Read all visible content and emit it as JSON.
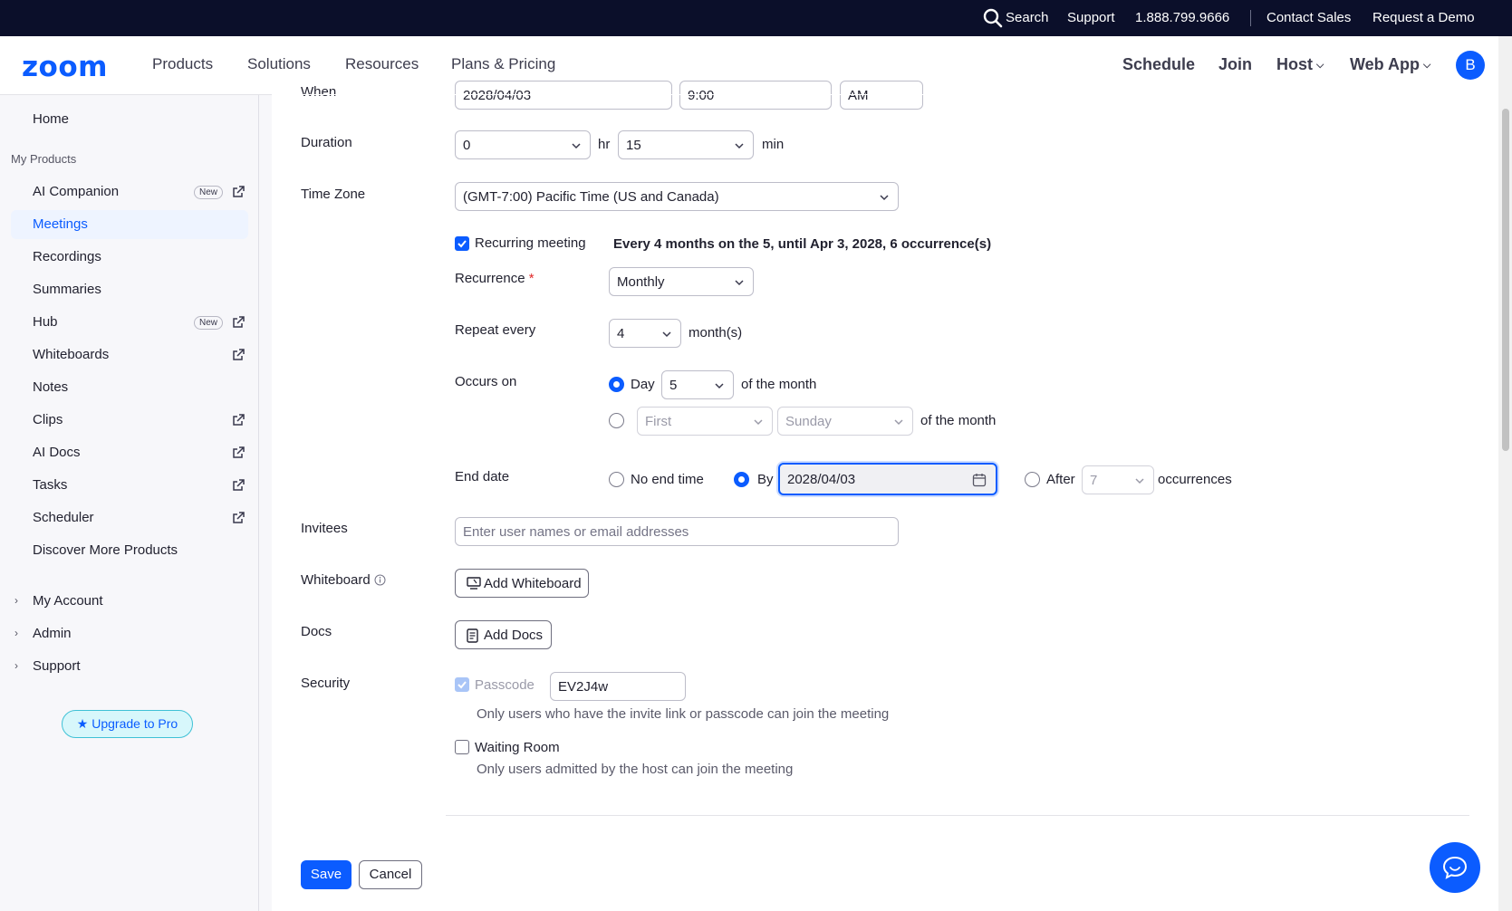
{
  "topbar": {
    "search": "Search",
    "support": "Support",
    "phone": "1.888.799.9666",
    "contact_sales": "Contact Sales",
    "request_demo": "Request a Demo"
  },
  "nav": {
    "logo": "zoom",
    "products": "Products",
    "solutions": "Solutions",
    "resources": "Resources",
    "plans": "Plans & Pricing",
    "schedule": "Schedule",
    "join": "Join",
    "host": "Host",
    "webapp": "Web App",
    "avatar_initial": "B"
  },
  "sidebar": {
    "home": "Home",
    "my_products": "My Products",
    "items": [
      {
        "label": "AI Companion",
        "badge": "New",
        "external": true
      },
      {
        "label": "Meetings",
        "active": true
      },
      {
        "label": "Recordings"
      },
      {
        "label": "Summaries"
      },
      {
        "label": "Hub",
        "badge": "New",
        "external": true
      },
      {
        "label": "Whiteboards",
        "external": true
      },
      {
        "label": "Notes"
      },
      {
        "label": "Clips",
        "external": true
      },
      {
        "label": "AI Docs",
        "external": true
      },
      {
        "label": "Tasks",
        "external": true
      },
      {
        "label": "Scheduler",
        "external": true
      },
      {
        "label": "Discover More Products"
      }
    ],
    "my_account": "My Account",
    "admin": "Admin",
    "support": "Support",
    "upgrade": "Upgrade to Pro"
  },
  "form": {
    "when": {
      "label": "When",
      "date": "2028/04/03",
      "time": "9:00",
      "ampm": "AM"
    },
    "duration": {
      "label": "Duration",
      "hours": "0",
      "hr_unit": "hr",
      "minutes": "15",
      "min_unit": "min"
    },
    "timezone": {
      "label": "Time Zone",
      "value": "(GMT-7:00) Pacific Time (US and Canada)"
    },
    "recurring": {
      "label": "Recurring meeting",
      "checked": true,
      "summary": "Every 4 months on the 5, until Apr 3, 2028, 6 occurrence(s)"
    },
    "recurrence": {
      "label": "Recurrence",
      "required_mark": "*",
      "value": "Monthly"
    },
    "repeat_every": {
      "label": "Repeat every",
      "value": "4",
      "unit": "month(s)"
    },
    "occurs_on": {
      "label": "Occurs on",
      "day_label": "Day",
      "day_value": "5",
      "of_month": "of the month",
      "week_value": "First",
      "weekday_value": "Sunday",
      "of_month_2": "of the month"
    },
    "end_date": {
      "label": "End date",
      "no_end": "No end time",
      "by_label": "By",
      "by_value": "2028/04/03",
      "after_label": "After",
      "after_value": "7",
      "occurrences": "occurrences"
    },
    "invitees": {
      "label": "Invitees",
      "placeholder": "Enter user names or email addresses"
    },
    "whiteboard": {
      "label": "Whiteboard",
      "button": "Add Whiteboard"
    },
    "docs": {
      "label": "Docs",
      "button": "Add Docs"
    },
    "security": {
      "label": "Security",
      "passcode_label": "Passcode",
      "passcode_value": "EV2J4w",
      "passcode_hint": "Only users who have the invite link or passcode can join the meeting",
      "waiting_room_label": "Waiting Room",
      "waiting_room_hint": "Only users admitted by the host can join the meeting"
    },
    "save": "Save",
    "cancel": "Cancel"
  },
  "colors": {
    "accent": "#0b5cff",
    "topbar": "#0b0f2a",
    "upgrade_bg": "#d7f7fb"
  }
}
